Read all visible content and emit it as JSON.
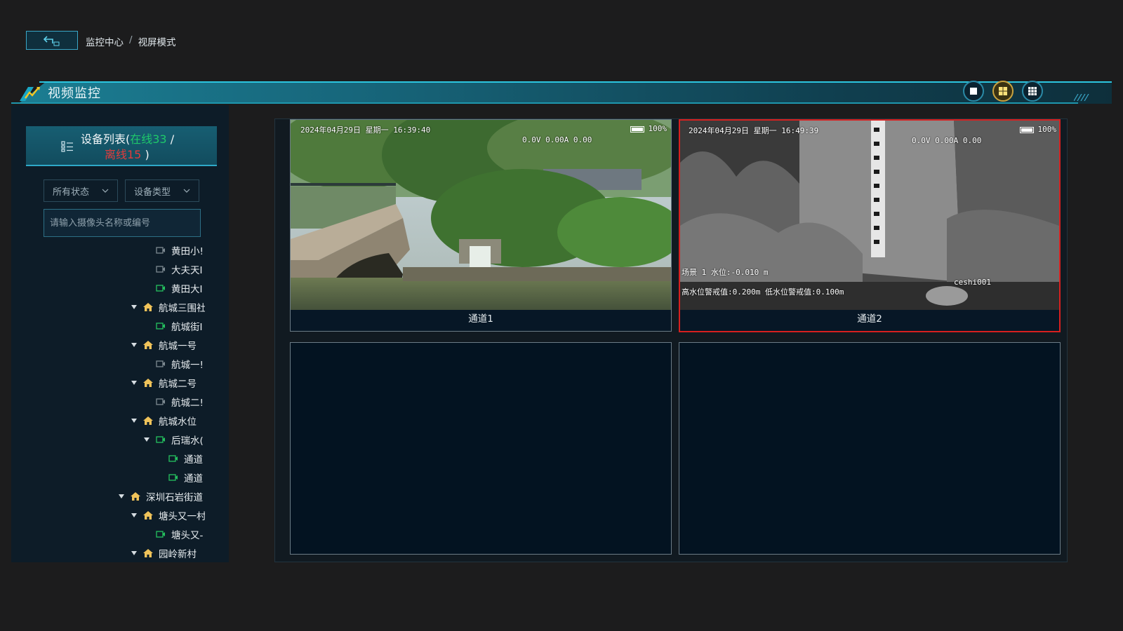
{
  "breadcrumb": {
    "items": [
      "监控中心",
      "视屏模式"
    ],
    "separator": "/"
  },
  "header": {
    "title": "视频监控"
  },
  "view_modes": [
    {
      "name": "single",
      "icon": "square-icon"
    },
    {
      "name": "quad",
      "icon": "grid-2x2-icon",
      "active": true
    },
    {
      "name": "nine",
      "icon": "grid-3x3-icon"
    }
  ],
  "device_list": {
    "title_prefix": "设备列表(",
    "online_label": "在线33",
    "divider": " /",
    "offline_label": "离线15",
    "title_suffix": " )",
    "filter_status": "所有状态",
    "filter_type": "设备类型",
    "search_placeholder": "请输入摄像头名称或编号"
  },
  "tree": [
    {
      "label": "黄田小!",
      "kind": "camera",
      "online": false,
      "level": 2
    },
    {
      "label": "大夫天I",
      "kind": "camera",
      "online": false,
      "level": 2
    },
    {
      "label": "黄田大I",
      "kind": "camera",
      "online": true,
      "level": 2
    },
    {
      "label": "航城三围社",
      "kind": "group",
      "level": 1
    },
    {
      "label": "航城街I",
      "kind": "camera",
      "online": true,
      "level": 2
    },
    {
      "label": "航城一号",
      "kind": "group",
      "level": 1
    },
    {
      "label": "航城一!",
      "kind": "camera",
      "online": false,
      "level": 2
    },
    {
      "label": "航城二号",
      "kind": "group",
      "level": 1
    },
    {
      "label": "航城二!",
      "kind": "camera",
      "online": false,
      "level": 2
    },
    {
      "label": "航城水位",
      "kind": "group",
      "level": 1
    },
    {
      "label": "后瑞水(",
      "kind": "camera-group",
      "online": true,
      "level": 2
    },
    {
      "label": "通道",
      "kind": "camera",
      "online": true,
      "level": 3
    },
    {
      "label": "通道",
      "kind": "camera",
      "online": true,
      "level": 3
    },
    {
      "label": "深圳石岩街道",
      "kind": "group",
      "level": 0
    },
    {
      "label": "塘头又一村",
      "kind": "group",
      "level": 1
    },
    {
      "label": "塘头又-",
      "kind": "camera",
      "online": true,
      "level": 2
    },
    {
      "label": "园岭新村",
      "kind": "group",
      "level": 1
    }
  ],
  "channels": [
    {
      "label": "通道1",
      "osd_time": "2024年04月29日  星期一  16:39:40",
      "osd_readings": "0.0V     0.00A    0.00",
      "battery": "100%"
    },
    {
      "label": "通道2",
      "osd_time": "2024年04月29日  星期一  16:49:39",
      "osd_readings": "0.0V     0.00A    0.00",
      "battery": "100%",
      "osd_scene": "场景 1 水位:-0.010 m",
      "osd_alarm": "高水位警戒值:0.200m  低水位警戒值:0.100m",
      "osd_device": "ceshi001",
      "selected": true
    },
    {
      "label": ""
    },
    {
      "label": ""
    }
  ]
}
